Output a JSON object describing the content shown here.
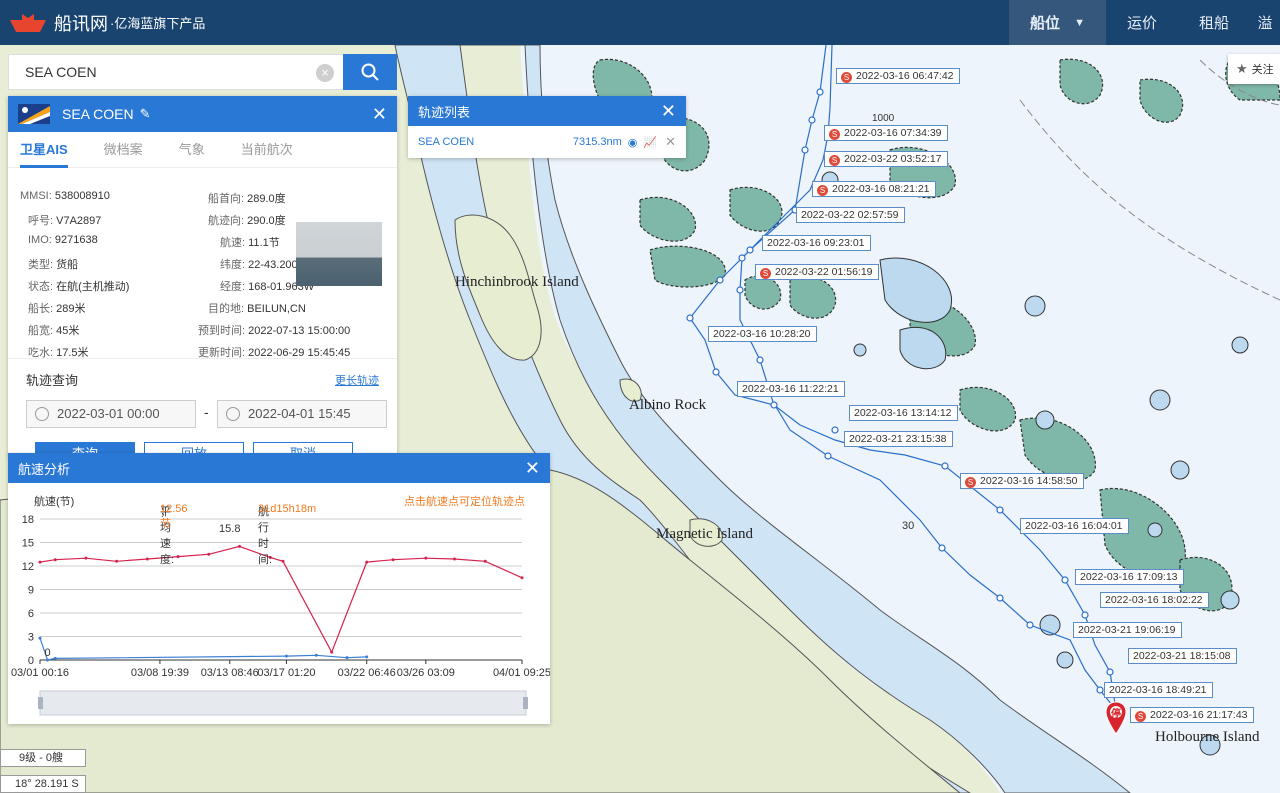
{
  "app": {
    "logo_main": "船讯网",
    "logo_sub": "·亿海蓝旗下产品",
    "nav": [
      {
        "label": "船位",
        "active": true
      },
      {
        "label": "运价"
      },
      {
        "label": "租船"
      },
      {
        "label": "溢"
      }
    ]
  },
  "search": {
    "value": "SEA COEN"
  },
  "ship_panel": {
    "title": "SEA COEN",
    "tabs": [
      "卫星AIS",
      "微档案",
      "气象",
      "当前航次"
    ],
    "fields_left": [
      {
        "label": "MMSI:",
        "value": "538008910"
      },
      {
        "label": "呼号:",
        "value": "V7A2897"
      },
      {
        "label": "IMO:",
        "value": "9271638"
      },
      {
        "label": "类型:",
        "value": "货船"
      },
      {
        "label": "状态:",
        "value": "在航(主机推动)"
      },
      {
        "label": "船长:",
        "value": "289米"
      },
      {
        "label": "船宽:",
        "value": "45米"
      },
      {
        "label": "吃水:",
        "value": "17.5米"
      }
    ],
    "fields_right": [
      {
        "label": "船首向:",
        "value": "289.0度"
      },
      {
        "label": "航迹向:",
        "value": "290.0度"
      },
      {
        "label": "航速:",
        "value": "11.1节"
      },
      {
        "label": "纬度:",
        "value": "22-43.200N"
      },
      {
        "label": "经度:",
        "value": "168-01.963W"
      },
      {
        "label": "目的地:",
        "value": "BEILUN,CN"
      },
      {
        "label": "预到时间:",
        "value": "2022-07-13 15:00:00"
      },
      {
        "label": "更新时间:",
        "value": "2022-06-29 15:45:45"
      }
    ],
    "track_query_title": "轨迹查询",
    "more_tracks": "更长轨迹",
    "date_from": "2022-03-01 00:00",
    "date_to": "2022-04-01 15:45",
    "dash": "-",
    "buttons": [
      "查询",
      "回放",
      "取消"
    ]
  },
  "track_list": {
    "title": "轨迹列表",
    "ship": "SEA COEN",
    "distance": "7315.3nm"
  },
  "speed_panel": {
    "title": "航速分析",
    "unit_label": "航速(节)",
    "avg_label": "平均速度:",
    "avg_value": "12.56节",
    "sep": "；",
    "time_label": "航行时间:",
    "time_value": "31d15h18m",
    "hint": "点击航速点可定位轨迹点"
  },
  "chart_data": {
    "type": "line",
    "ylabel": "航速(节)",
    "ylim": [
      0,
      18
    ],
    "yticks": [
      0,
      3,
      6,
      9,
      12,
      15,
      18
    ],
    "xlim": [
      "03/01 00:16",
      "04/01 09:25"
    ],
    "xticks": [
      "03/01 00:16",
      "03/08 19:39",
      "03/13 08:46",
      "03/17 01:20",
      "03/22 06:46",
      "03/26 03:09",
      "04/01 09:25"
    ],
    "annotations": [
      {
        "label": "15.8",
        "x": "03/13 08:46",
        "y": 15.8
      },
      {
        "label": "0",
        "x": "03/01 12:00",
        "y": 0
      }
    ],
    "series": [
      {
        "color": "#d6234e",
        "x": [
          "03/01 00:16",
          "03/02 00:00",
          "03/04 00:00",
          "03/06 00:00",
          "03/08 00:00",
          "03/10 00:00",
          "03/12 00:00",
          "03/14 00:00",
          "03/16 00:00",
          "03/16 20:00",
          "03/20 00:00",
          "03/22 06:46",
          "03/24 00:00",
          "03/26 03:09",
          "03/28 00:00",
          "03/30 00:00",
          "04/01 09:25"
        ],
        "y": [
          12.5,
          12.8,
          13.0,
          12.6,
          12.9,
          13.2,
          13.5,
          14.5,
          13.1,
          12.6,
          1.0,
          12.5,
          12.8,
          13.0,
          12.9,
          12.6,
          10.5
        ]
      },
      {
        "color": "#3b7fd4",
        "x": [
          "03/01 00:16",
          "03/01 12:00",
          "03/02 00:00",
          "03/17 01:20",
          "03/19 00:00",
          "03/21 00:00",
          "03/22 06:46"
        ],
        "y": [
          2.8,
          0.0,
          0.2,
          0.5,
          0.6,
          0.3,
          0.4
        ]
      }
    ]
  },
  "map": {
    "places": [
      "Hinchinbrook Island",
      "Albino Rock",
      "Magnetic Island",
      "Holbourne Island"
    ],
    "depth_labels": [
      "1000",
      "30"
    ],
    "track_labels": [
      "2022-03-16 06:47:42",
      "2022-03-16 07:34:39",
      "2022-03-22 03:52:17",
      "2022-03-16 08:21:21",
      "2022-03-22 02:57:59",
      "2022-03-16 09:23:01",
      "2022-03-22 01:56:19",
      "2022-03-16 10:28:20",
      "2022-03-16 11:22:21",
      "2022-03-16 13:14:12",
      "2022-03-21 23:15:38",
      "2022-03-16 14:58:50",
      "2022-03-16 16:04:01",
      "2022-03-16 17:09:13",
      "2022-03-16 18:02:22",
      "2022-03-21 19:06:19",
      "2022-03-21 18:15:08",
      "2022-03-16 18:49:21",
      "2022-03-16 21:17:43"
    ],
    "stop_marker": "停",
    "follow_label": "关注",
    "scale_label": "9级 - 0艘",
    "coord_label": "18° 28.191 S"
  },
  "colors": {
    "header": "#1a4470",
    "accent": "#2a78d5",
    "sea": "#d2e8f8",
    "reef": "#7fb8a8",
    "land": "#e6edd0"
  }
}
